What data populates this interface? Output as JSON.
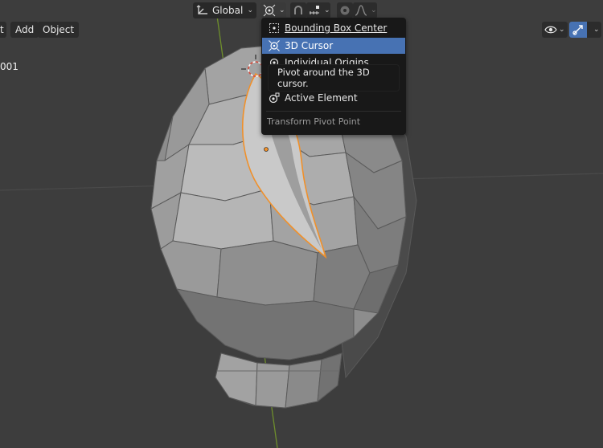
{
  "header": {
    "orientation": {
      "label": "Global"
    }
  },
  "menubar": {
    "items": [
      {
        "label": "t"
      },
      {
        "label": "Add"
      },
      {
        "label": "Object"
      }
    ]
  },
  "viewport": {
    "object_name": "001"
  },
  "pivot_menu": {
    "items": [
      {
        "label": "Bounding Box Center",
        "selected": false
      },
      {
        "label": "3D Cursor",
        "selected": true
      },
      {
        "label": "Individual Origins",
        "selected": false
      },
      {
        "label": "Active Element",
        "selected": false
      }
    ],
    "title": "Transform Pivot Point"
  },
  "tooltip": {
    "text": "Pivot around the 3D cursor."
  },
  "colors": {
    "viewport_bg": "#3d3d3d",
    "menu_bg": "#181818",
    "selection": "#4772b3",
    "outline_orange": "#f0902a",
    "axis_green": "#7a9a3a"
  }
}
